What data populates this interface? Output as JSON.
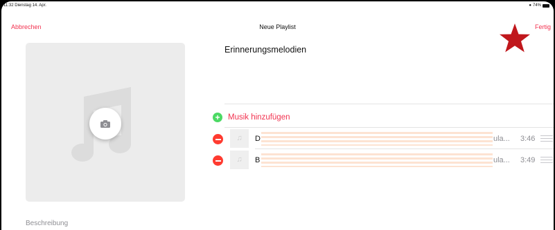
{
  "status_bar": {
    "time_date": "11:32  Dienstag 14. Apr.",
    "wifi_icon": "wifi-icon",
    "battery_percent": "74%"
  },
  "navbar": {
    "cancel_label": "Abbrechen",
    "title": "Neue Playlist",
    "done_label": "Fertig"
  },
  "annotation": {
    "icon": "star-icon",
    "color": "#c0171c"
  },
  "artwork": {
    "icon": "music-note-icon",
    "camera_icon": "camera-icon"
  },
  "playlist": {
    "name": "Erinnerungsmelodien",
    "add_music_label": "Musik hinzufügen",
    "songs": [
      {
        "title": "D",
        "artist": "ula...",
        "duration": "3:46"
      },
      {
        "title": "B",
        "artist": "ula...",
        "duration": "3:49"
      }
    ]
  },
  "description_label": "Beschreibung",
  "colors": {
    "accent": "#f2324f",
    "add_green": "#4cd964",
    "remove_red": "#ff3b30",
    "artwork_bg": "#ececec"
  }
}
